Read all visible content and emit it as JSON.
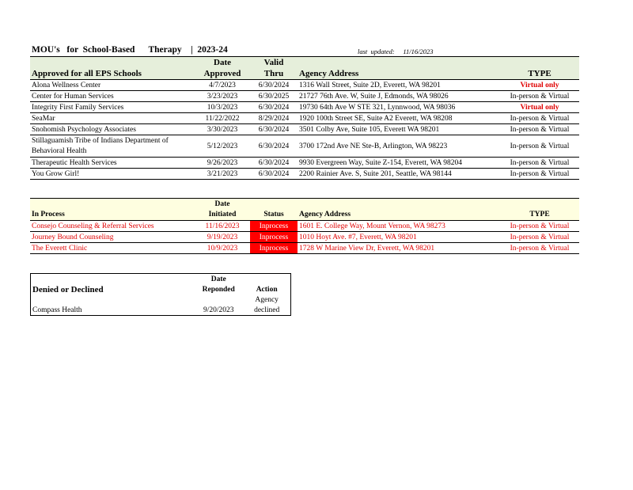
{
  "header": {
    "title": "MOU's   for  School-Based      Therapy    |  2023-24",
    "last_updated": "last  updated:     11/16/2023"
  },
  "approved": {
    "headers": {
      "name": "Approved for all EPS Schools",
      "date_line1": "Date",
      "date_line2": "Approved",
      "valid_line1": "Valid",
      "valid_line2": "Thru",
      "address": "Agency Address",
      "type": "TYPE"
    },
    "rows": [
      {
        "name": "Alona Wellness Center",
        "date": "4/7/2023",
        "valid": "6/30/2024",
        "address": "1316 Wall Street,  Suite 2D, Everett,  WA 98201",
        "type": "Virtual only"
      },
      {
        "name": "Center for Human   Services",
        "date": "3/23/2023",
        "valid": "6/30/2025",
        "address": "21727 76th  Ave. W, Suite J, Edmonds,  WA 98026",
        "type": "In-person &  Virtual"
      },
      {
        "name": "Integrity First Family Services",
        "date": "10/3/2023",
        "valid": "6/30/2024",
        "address": "19730 64th  Ave W STE 321,  Lynnwood, WA 98036",
        "type": "Virtual only"
      },
      {
        "name": "SeaMar",
        "date": "11/22/2022",
        "valid": "8/29/2024",
        "address": "1920 100th  Street  SE, Suite A2 Everett,  WA 98208",
        "type": "In-person &  Virtual"
      },
      {
        "name": "Snohomish Psychology Associates",
        "date": "3/30/2023",
        "valid": "6/30/2024",
        "address": "3501 Colby Ave, Suite 105,  Everett  WA 98201",
        "type": "In-person &  Virtual"
      },
      {
        "name": "Stillaguamish Tribe of Indians Department   of Behavioral Health",
        "date": "5/12/2023",
        "valid": "6/30/2024",
        "address": "3700 172nd  Ave NE Ste-B, Arlington, WA 98223",
        "type": "In-person &  Virtual"
      },
      {
        "name": "Therapeutic  Health  Services",
        "date": "9/26/2023",
        "valid": "6/30/2024",
        "address": "9930 Evergreen  Way,  Suite Z-154, Everett,  WA 98204",
        "type": "In-person &  Virtual"
      },
      {
        "name": "You Grow Girl!",
        "date": "3/21/2023",
        "valid": "6/30/2024",
        "address": "2200 Rainier Ave. S, Suite 201,  Seattle,  WA 98144",
        "type": "In-person &  Virtual"
      }
    ]
  },
  "in_process": {
    "headers": {
      "name": "In Process",
      "date_line1": "Date",
      "date_line2": "Initiated",
      "status": "Status",
      "address": "Agency Address",
      "type": "TYPE"
    },
    "rows": [
      {
        "name": "Consejo Counseling & Referral   Services",
        "date": "11/16/2023",
        "status": "Inprocess",
        "address": "1601 E. College Way, Mount  Vernon,  WA 98273",
        "type": "In-person &  Virtual"
      },
      {
        "name": "Journey  Bound Counseling",
        "date": "9/19/2023",
        "status": "Inprocess",
        "address": "1010 Hoyt  Ave. #7,  Everett,  WA 98201",
        "type": "In-person &  Virtual"
      },
      {
        "name": "The Everett  Clinic",
        "date": "10/9/2023",
        "status": "Inprocess",
        "address": "1728 W  Marine  View Dr, Everett,  WA 98201",
        "type": "In-person &  Virtual"
      }
    ]
  },
  "denied": {
    "headers": {
      "name": "Denied or Declined",
      "date_line1": "Date",
      "date_line2": "Reponded",
      "action": "Action"
    },
    "rows": [
      {
        "name": "Compass Health",
        "date": "9/20/2023",
        "action_line1": "Agency",
        "action_line2": "declined"
      }
    ]
  },
  "colors": {
    "approved_header": "#e6efdb",
    "in_process_header": "#fefee0",
    "status_fill": "#ff0000",
    "red_text": "#e00000"
  }
}
